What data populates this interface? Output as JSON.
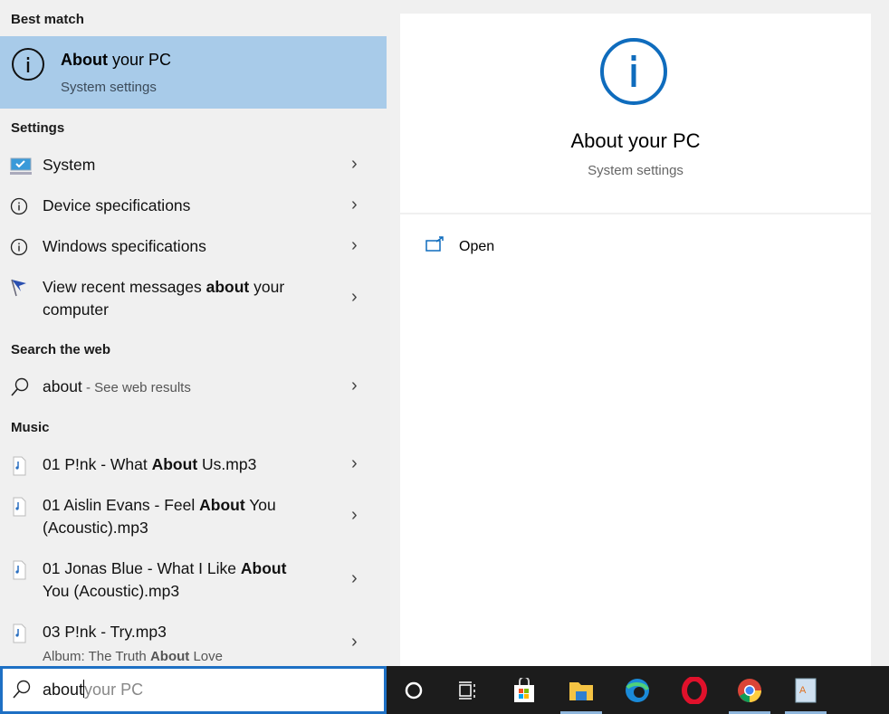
{
  "sections": {
    "best_match": "Best match",
    "settings": "Settings",
    "search_web": "Search the web",
    "music": "Music"
  },
  "best_match": {
    "title_bold": "About",
    "title_rest": " your PC",
    "subtitle": "System settings",
    "icon": "info-icon"
  },
  "settings_items": [
    {
      "label": "System",
      "icon": "monitor-icon"
    },
    {
      "label": "Device specifications",
      "icon": "info-icon"
    },
    {
      "label": "Windows specifications",
      "icon": "info-icon"
    },
    {
      "pre": "View recent messages ",
      "bold": "about",
      "post": " your computer",
      "icon": "flag-icon"
    }
  ],
  "web": {
    "query": "about",
    "suffix": " - See web results",
    "icon": "search-icon"
  },
  "music_items": [
    {
      "pre": "01 P!nk - What ",
      "bold": "About",
      "post": " Us.mp3"
    },
    {
      "pre": "01 Aislin Evans - Feel ",
      "bold": "About",
      "post": " You (Acoustic).mp3"
    },
    {
      "pre": "01 Jonas Blue - What I Like ",
      "bold": "About",
      "post": " You (Acoustic).mp3"
    },
    {
      "pre": "03 P!nk - Try.mp3",
      "sub_pre": "Album: The Truth ",
      "sub_bold": "About",
      "sub_post": " Love"
    }
  ],
  "preview": {
    "title": "About your PC",
    "subtitle": "System settings",
    "open_label": "Open",
    "accent": "#0f6cbd"
  },
  "search": {
    "value": "about",
    "placeholder_completion": "your PC"
  },
  "taskbar": [
    "cortana",
    "task-view",
    "microsoft-store",
    "file-explorer",
    "edge",
    "opera",
    "chrome",
    "app"
  ],
  "colors": {
    "highlight": "#a8cbe9",
    "search_border": "#1e70c4",
    "taskbar": "#1c1c1c"
  }
}
